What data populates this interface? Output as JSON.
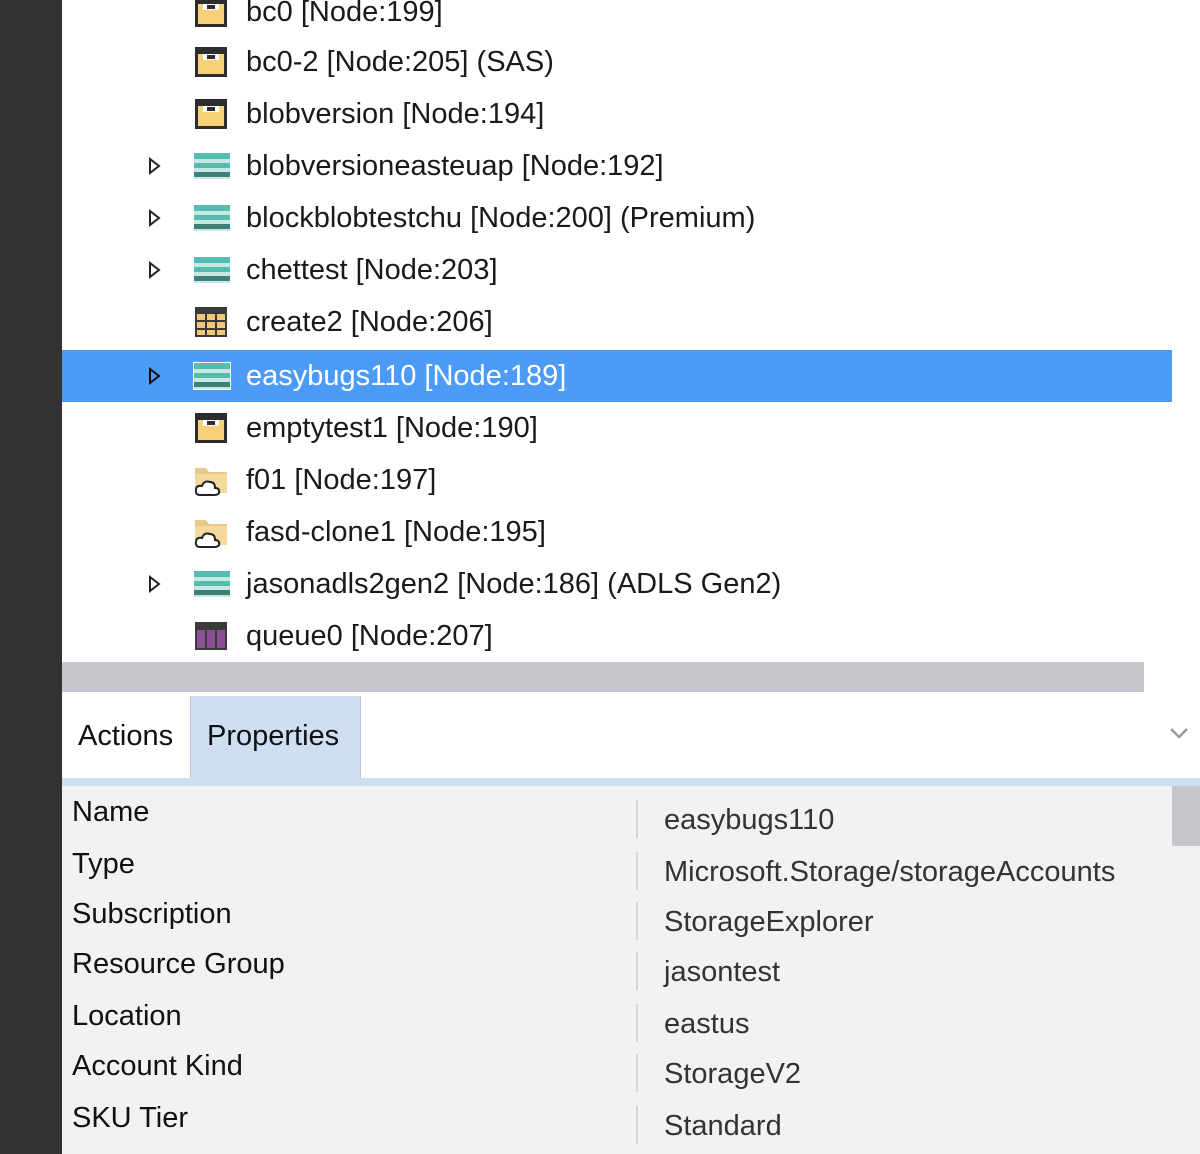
{
  "tree": {
    "items": [
      {
        "label": "bc0 [Node:199]",
        "icon": "blob-container-icon",
        "expandable": false,
        "selected": false
      },
      {
        "label": "bc0-2 [Node:205] (SAS)",
        "icon": "blob-container-icon",
        "expandable": false,
        "selected": false
      },
      {
        "label": "blobversion [Node:194]",
        "icon": "blob-container-icon",
        "expandable": false,
        "selected": false
      },
      {
        "label": "blobversioneasteuap [Node:192]",
        "icon": "storage-account-icon",
        "expandable": true,
        "selected": false
      },
      {
        "label": "blockblobtestchu [Node:200] (Premium)",
        "icon": "storage-account-icon",
        "expandable": true,
        "selected": false
      },
      {
        "label": "chettest [Node:203]",
        "icon": "storage-account-icon",
        "expandable": true,
        "selected": false
      },
      {
        "label": "create2 [Node:206]",
        "icon": "table-icon",
        "expandable": false,
        "selected": false
      },
      {
        "label": "easybugs110 [Node:189]",
        "icon": "storage-account-icon",
        "expandable": true,
        "selected": true
      },
      {
        "label": "emptytest1 [Node:190]",
        "icon": "blob-container-icon",
        "expandable": false,
        "selected": false
      },
      {
        "label": "f01 [Node:197]",
        "icon": "file-share-icon",
        "expandable": false,
        "selected": false
      },
      {
        "label": "fasd-clone1 [Node:195]",
        "icon": "file-share-icon",
        "expandable": false,
        "selected": false
      },
      {
        "label": "jasonadls2gen2 [Node:186] (ADLS Gen2)",
        "icon": "storage-account-icon",
        "expandable": true,
        "selected": false
      },
      {
        "label": "queue0 [Node:207]",
        "icon": "queue-icon",
        "expandable": false,
        "selected": false
      }
    ]
  },
  "panel": {
    "tabs": [
      {
        "label": "Actions",
        "active": false
      },
      {
        "label": "Properties",
        "active": true
      }
    ],
    "properties": [
      {
        "name": "Name",
        "value": "easybugs110"
      },
      {
        "name": "Type",
        "value": "Microsoft.Storage/storageAccounts"
      },
      {
        "name": "Subscription",
        "value": "StorageExplorer"
      },
      {
        "name": "Resource Group",
        "value": "jasontest"
      },
      {
        "name": "Location",
        "value": "eastus"
      },
      {
        "name": "Account Kind",
        "value": "StorageV2"
      },
      {
        "name": "SKU Tier",
        "value": "Standard"
      }
    ]
  },
  "colors": {
    "selection": "#4c9bf8",
    "active_tab": "#cfdff3",
    "sidebar": "#333333"
  }
}
